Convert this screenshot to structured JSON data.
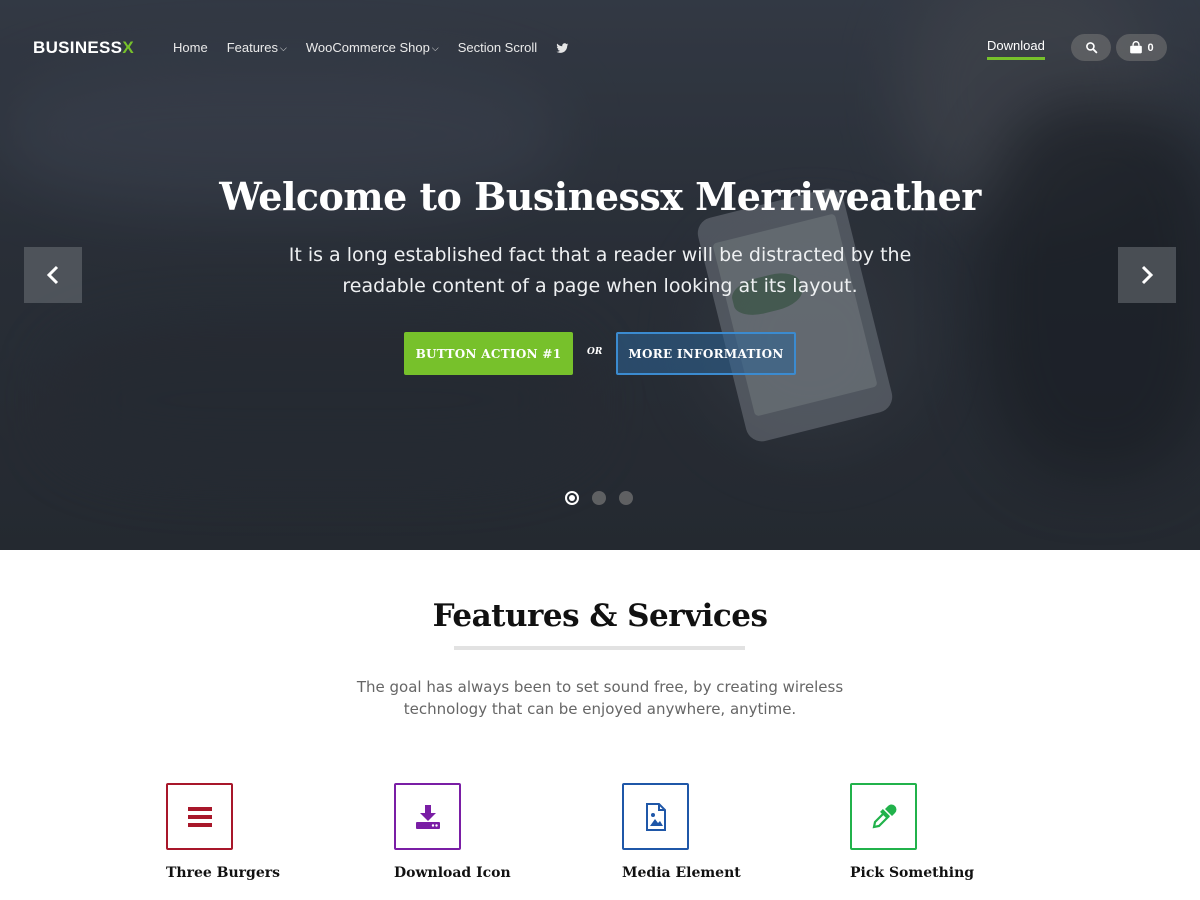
{
  "brand": {
    "logo_main": "BUSINESS",
    "logo_accent": "X",
    "accent_color": "#77c12b"
  },
  "nav": {
    "items": [
      {
        "label": "Home",
        "has_dropdown": false
      },
      {
        "label": "Features",
        "has_dropdown": true
      },
      {
        "label": "WooCommerce Shop",
        "has_dropdown": true
      },
      {
        "label": "Section Scroll",
        "has_dropdown": false
      }
    ],
    "social_icon": "twitter-icon",
    "download_label": "Download",
    "cart_count": "0"
  },
  "hero": {
    "title": "Welcome to Businessx Merriweather",
    "subtitle": "It is a long established fact that a reader will be distracted by the readable content of a page when looking at its layout.",
    "button_primary": "BUTTON ACTION #1",
    "or_label": "OR",
    "button_secondary": "MORE INFORMATION",
    "slides_total": 3,
    "active_slide": 1
  },
  "features": {
    "title": "Features & Services",
    "description": "The goal has always been to set sound free, by creating wireless technology that can be enjoyed anywhere, anytime.",
    "items": [
      {
        "label": "Three Burgers",
        "icon": "hamburger-icon",
        "color": "#a8172a"
      },
      {
        "label": "Download Icon",
        "icon": "download-icon",
        "color": "#7a1ea5"
      },
      {
        "label": "Media Element",
        "icon": "image-file-icon",
        "color": "#1f57a8"
      },
      {
        "label": "Pick Something",
        "icon": "eyedropper-icon",
        "color": "#21b24b"
      }
    ]
  }
}
